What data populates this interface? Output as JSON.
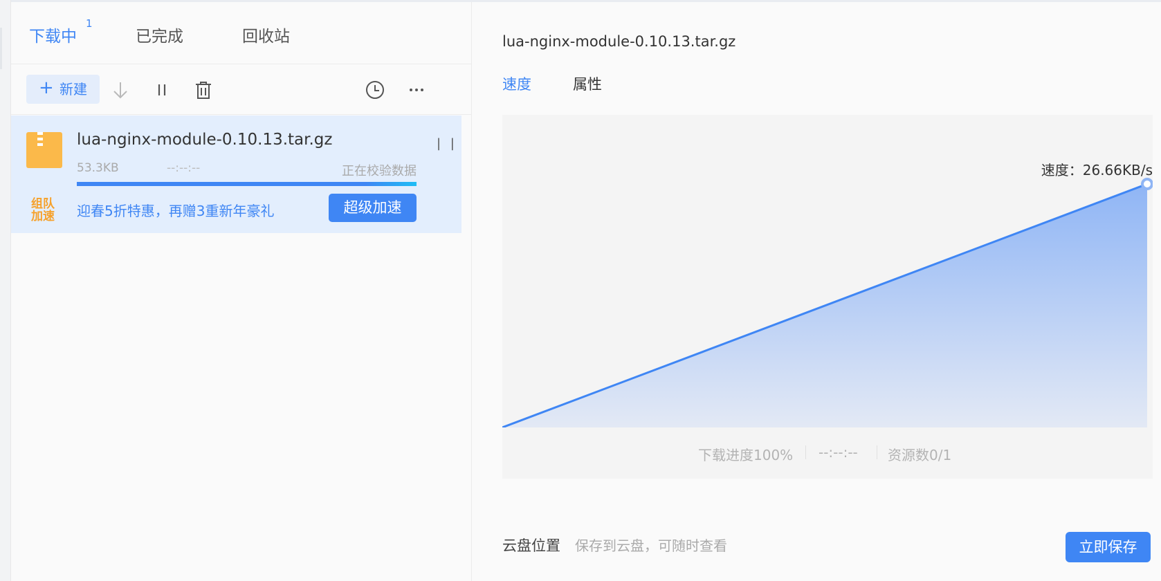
{
  "tabs": {
    "downloading": "下载中",
    "downloading_count": "1",
    "completed": "已完成",
    "recycle": "回收站"
  },
  "toolbar": {
    "new_label": "新建",
    "icons": [
      "download-icon",
      "pause-icon",
      "trash-icon",
      "clock-icon",
      "more-icon"
    ]
  },
  "task": {
    "name": "lua-nginx-module-0.10.13.tar.gz",
    "size": "53.3KB",
    "time": "--:--:--",
    "status": "正在校验数据",
    "progress": 1.0,
    "team_line1": "组队",
    "team_line2": "加速",
    "promo": "迎春5折特惠，再赠3重新年豪礼",
    "boost_label": "超级加速"
  },
  "detail": {
    "title": "lua-nginx-module-0.10.13.tar.gz",
    "tab_speed": "速度",
    "tab_props": "属性",
    "speed_text": "速度：26.66KB/s",
    "progress_text": "下载进度100%",
    "time_text": "--:--:--",
    "sources_text": "资源数0/1",
    "cloud_label": "云盘位置",
    "cloud_hint": "保存到云盘，可随时查看",
    "save_label": "立即保存"
  },
  "chart_data": {
    "type": "area",
    "x": [
      0,
      1
    ],
    "values": [
      0,
      26.66
    ],
    "unit": "KB/s",
    "color": "#3f86f4"
  },
  "colors": {
    "accent": "#3f86f4",
    "team": "#f6a12b",
    "file_icon": "#fbb94a"
  }
}
